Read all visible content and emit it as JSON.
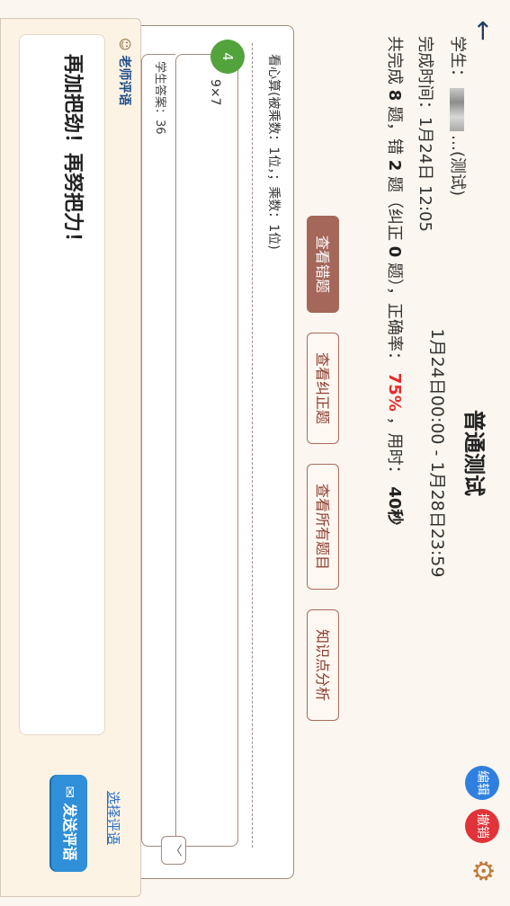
{
  "header": {
    "title": "普通测试",
    "period": "1月24日00:00 - 1月28日23:59"
  },
  "student": {
    "label": "学生：",
    "suffix": "…(测试)",
    "finish_time": "完成时间：1月24日 12:05",
    "summary_prefix": "共完成",
    "total": "8",
    "mid1": "题，错",
    "wrong": "2",
    "mid2": "题（纠正",
    "corrected": "0",
    "mid3": "题），正确率：",
    "accuracy": "75%",
    "mid4": "，用时：",
    "time_used": "40秒"
  },
  "tabs": [
    {
      "label": "查看错题"
    },
    {
      "label": "查看纠正题"
    },
    {
      "label": "查看所有题目"
    },
    {
      "label": "知识点分析"
    }
  ],
  "actions": {
    "edit": "编辑",
    "revoke": "撤销"
  },
  "question": {
    "header": "看心算(被乘数：1位，；乘数：1位)",
    "number": "4",
    "text": "9×7",
    "answer": "学生答案：36"
  },
  "comment": {
    "label": "老师评语",
    "text": "再加把劲！再努把力！",
    "choose": "选择评语",
    "send": "发送评语"
  },
  "colors": {
    "accent": "#a5675a",
    "edit_blue": "#2f7fe0",
    "revoke_red": "#e0343a",
    "badge_green": "#53a33c"
  }
}
